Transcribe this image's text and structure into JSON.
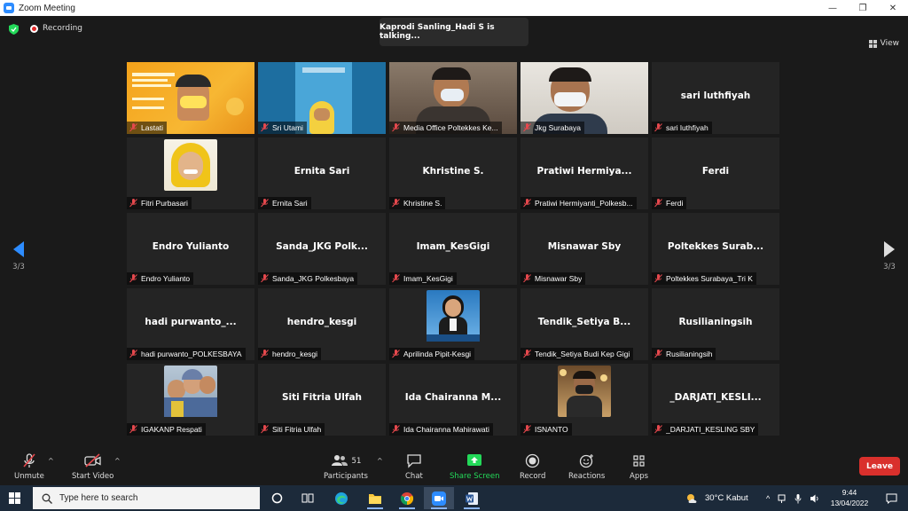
{
  "window": {
    "title": "Zoom Meeting",
    "controls": {
      "minimize": "—",
      "restore": "❐",
      "close": "✕"
    }
  },
  "topbar": {
    "recording_label": "Recording",
    "talking_indicator": "Kaprodi Sanling_Hadi S is talking...",
    "view_label": "View"
  },
  "gallery": {
    "page_left": "3/3",
    "page_right": "3/3",
    "tiles": [
      {
        "name": "Lastati",
        "big": "",
        "video": true
      },
      {
        "name": "Sri Utami",
        "big": "",
        "video": true
      },
      {
        "name": "Media Office Poltekkes Ke...",
        "big": "",
        "video": true
      },
      {
        "name": "Jkg Surabaya",
        "big": "",
        "video": true
      },
      {
        "name": "sari luthfiyah",
        "big": "sari luthfiyah",
        "video": false
      },
      {
        "name": "Fitri Purbasari",
        "big": "",
        "video": true
      },
      {
        "name": "Ernita Sari",
        "big": "Ernita Sari",
        "video": false
      },
      {
        "name": "Khristine S.",
        "big": "Khristine S.",
        "video": false
      },
      {
        "name": "Pratiwi Hermiyanti_Polkesb...",
        "big": "Pratiwi  Hermiya...",
        "video": false
      },
      {
        "name": "Ferdi",
        "big": "Ferdi",
        "video": false
      },
      {
        "name": "Endro Yulianto",
        "big": "Endro Yulianto",
        "video": false
      },
      {
        "name": "Sanda_JKG Polkesbaya",
        "big": "Sanda_JKG  Polk...",
        "video": false
      },
      {
        "name": "Imam_KesGigi",
        "big": "Imam_KesGigi",
        "video": false
      },
      {
        "name": "Misnawar Sby",
        "big": "Misnawar Sby",
        "video": false
      },
      {
        "name": "Poltekkes Surabaya_Tri K",
        "big": "Poltekkes  Surab...",
        "video": false
      },
      {
        "name": "hadi purwanto_POLKESBAYA",
        "big": "hadi  purwanto_...",
        "video": false
      },
      {
        "name": "hendro_kesgi",
        "big": "hendro_kesgi",
        "video": false
      },
      {
        "name": "Aprilinda Pipit-Kesgi",
        "big": "",
        "video": true
      },
      {
        "name": "Tendik_Setiya Budi Kep Gigi",
        "big": "Tendik_Setiya  B...",
        "video": false
      },
      {
        "name": "Rusilianingsih",
        "big": "Rusilianingsih",
        "video": false
      },
      {
        "name": "IGAKANP Respati",
        "big": "",
        "video": true
      },
      {
        "name": "Siti Fitria Ulfah",
        "big": "Siti Fitria Ulfah",
        "video": false
      },
      {
        "name": "Ida Chairanna Mahirawati",
        "big": "Ida  Chairanna  M...",
        "video": false
      },
      {
        "name": "ISNANTO",
        "big": "",
        "video": true
      },
      {
        "name": "_DARJATI_KESLING SBY",
        "big": "_DARJATI_KESLI...",
        "video": false
      }
    ]
  },
  "toolbar": {
    "unmute": "Unmute",
    "start_video": "Start Video",
    "participants": "Participants",
    "participants_count": "51",
    "chat": "Chat",
    "share_screen": "Share Screen",
    "record": "Record",
    "reactions": "Reactions",
    "apps": "Apps",
    "leave": "Leave"
  },
  "colors": {
    "accent": "#2d8cff",
    "share_green": "#23d959",
    "leave_red": "#d9302c",
    "mic_muted_red": "#e5484d"
  },
  "taskbar": {
    "search_placeholder": "Type here to search",
    "weather": "30°C  Kabut",
    "time": "9:44",
    "date": "13/04/2022"
  }
}
